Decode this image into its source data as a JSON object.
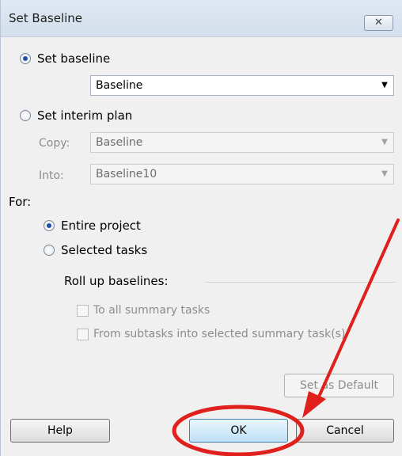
{
  "window": {
    "title": "Set Baseline",
    "close_glyph": "✕"
  },
  "set_baseline": {
    "label": "Set baseline",
    "selected": true,
    "combo_value": "Baseline"
  },
  "set_interim_plan": {
    "label": "Set interim plan",
    "selected": false,
    "copy_label": "Copy:",
    "copy_value": "Baseline",
    "into_label": "Into:",
    "into_value": "Baseline10"
  },
  "for_section": {
    "label": "For:",
    "entire_project": "Entire project",
    "selected_tasks": "Selected tasks",
    "selected": "entire_project"
  },
  "roll_up": {
    "label": "Roll up baselines:",
    "to_all_summary": "To all summary tasks",
    "from_subtasks": "From subtasks into selected summary task(s)"
  },
  "buttons": {
    "set_as_default": "Set as Default",
    "help": "Help",
    "ok": "OK",
    "cancel": "Cancel"
  },
  "annotation": {
    "color": "#e0201c"
  }
}
